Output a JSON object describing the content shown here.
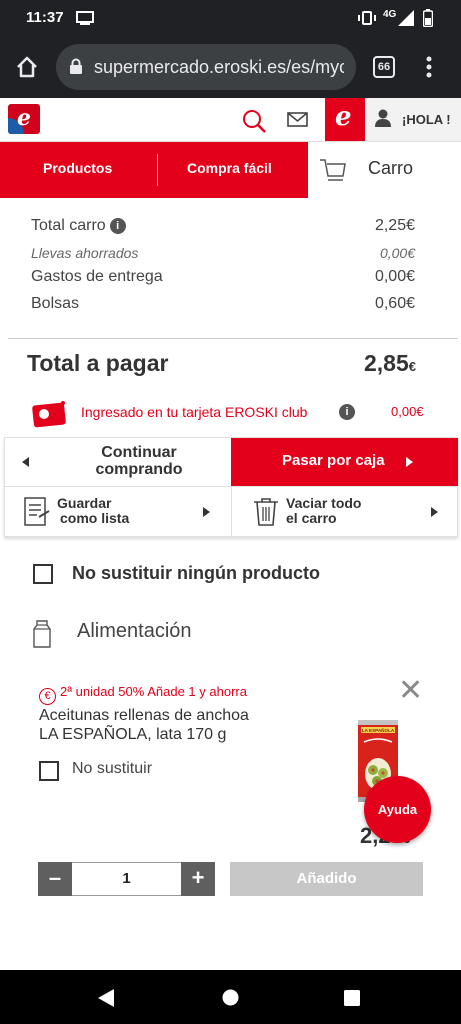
{
  "status_bar": {
    "time": "11:37",
    "network": "4G"
  },
  "browser": {
    "url": "supermercado.eroski.es/es/myc",
    "tabs_count": "66"
  },
  "header": {
    "greeting": "¡HOLA !"
  },
  "nav": {
    "products": "Productos",
    "easy_buy": "Compra fácil",
    "cart": "Carro"
  },
  "summary": {
    "total_cart_label": "Total carro",
    "total_cart_value": "2,25€",
    "saved_label": "Llevas ahorrados",
    "saved_value": "0,00€",
    "delivery_label": "Gastos de entrega",
    "delivery_value": "0,00€",
    "bags_label": "Bolsas",
    "bags_value": "0,60€"
  },
  "total": {
    "label": "Total a pagar",
    "value": "2,85",
    "currency": "€"
  },
  "club": {
    "text": "Ingresado en tu tarjeta EROSKI club",
    "value": "0,00€"
  },
  "actions": {
    "continue_line1": "Continuar",
    "continue_line2": "comprando",
    "checkout": "Pasar por caja",
    "save_line1": "Guardar",
    "save_line2": "como lista",
    "empty_line1": "Vaciar todo",
    "empty_line2": "el carro"
  },
  "no_substitute_all": "No sustituir ningún producto",
  "category": "Alimentación",
  "product": {
    "promo": "2ª unidad 50% Añade 1 y ahorra",
    "name_line1": "Aceitunas rellenas de anchoa",
    "name_line2": "LA ESPAÑOLA, lata 170 g",
    "no_substitute": "No sustituir",
    "price": "2,25",
    "currency": "€",
    "quantity": "1",
    "added_label": "Añadido",
    "can_brand": "LA ESPAÑOLA"
  },
  "help": "Ayuda",
  "colors": {
    "brand_red": "#e2001a",
    "brand_blue": "#1d5ca8"
  }
}
